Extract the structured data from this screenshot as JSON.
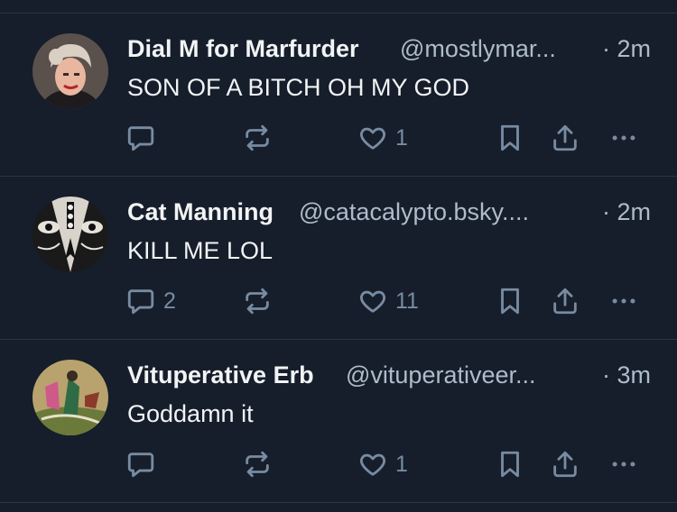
{
  "posts": [
    {
      "name": "Dial M for Marfurder",
      "handle": "@mostlymar...",
      "time": "· 2m",
      "text": "SON OF A BITCH OH MY GOD",
      "replies": "",
      "likes": "1"
    },
    {
      "name": "Cat Manning",
      "handle": "@catacalypto.bsky....",
      "time": "· 2m",
      "text": "KILL ME LOL",
      "replies": "2",
      "likes": "11"
    },
    {
      "name": "Vituperative Erb",
      "handle": "@vituperativeer...",
      "time": "· 3m",
      "text": "Goddamn it",
      "replies": "",
      "likes": "1"
    }
  ],
  "colors": {
    "background": "#151e2a",
    "divider": "#2a3646",
    "name": "#f1f3f5",
    "muted": "#aebbc9",
    "icon": "#788ba2"
  },
  "icons": [
    "reply-icon",
    "repost-icon",
    "like-icon",
    "bookmark-icon",
    "share-icon",
    "more-icon"
  ]
}
